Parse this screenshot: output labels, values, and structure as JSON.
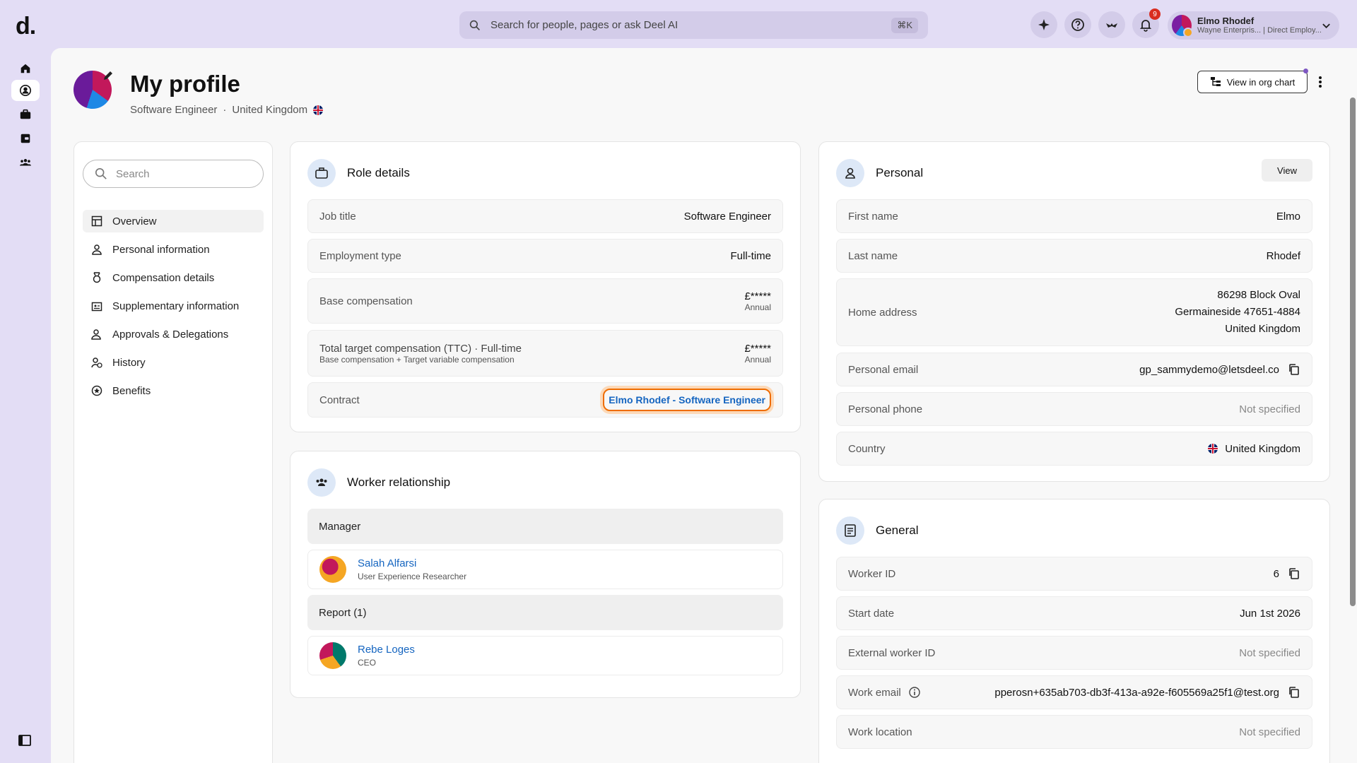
{
  "app": {
    "logo": "d."
  },
  "search": {
    "placeholder": "Search for people, pages or ask Deel AI",
    "shortcut": "⌘K"
  },
  "topbar": {
    "notification_count": "9"
  },
  "user": {
    "name": "Elmo Rhodef",
    "subtitle": "Wayne Enterpris... | Direct Employ..."
  },
  "header": {
    "title": "My profile",
    "job": "Software Engineer",
    "separator": "·",
    "country": "United Kingdom",
    "org_chart_button": "View in org chart"
  },
  "nav": {
    "search_placeholder": "Search",
    "items": [
      {
        "label": "Overview",
        "icon": "layout-icon"
      },
      {
        "label": "Personal information",
        "icon": "person-icon"
      },
      {
        "label": "Compensation details",
        "icon": "medal-icon"
      },
      {
        "label": "Supplementary information",
        "icon": "id-card-icon"
      },
      {
        "label": "Approvals & Delegations",
        "icon": "person-check-icon"
      },
      {
        "label": "History",
        "icon": "person-history-icon"
      },
      {
        "label": "Benefits",
        "icon": "star-badge-icon"
      }
    ]
  },
  "role": {
    "title": "Role details",
    "job_title_label": "Job title",
    "job_title": "Software Engineer",
    "employment_type_label": "Employment type",
    "employment_type": "Full-time",
    "base_comp_label": "Base compensation",
    "base_comp": "£*****",
    "base_comp_period": "Annual",
    "ttc_label": "Total target compensation (TTC) · Full-time",
    "ttc_sub": "Base compensation + Target variable compensation",
    "ttc": "£*****",
    "ttc_period": "Annual",
    "contract_label": "Contract",
    "contract": "Elmo Rhodef - Software Engineer"
  },
  "worker": {
    "title": "Worker relationship",
    "manager_label": "Manager",
    "manager_name": "Salah Alfarsi",
    "manager_role": "User Experience Researcher",
    "report_label": "Report (1)",
    "report_name": "Rebe Loges",
    "report_role": "CEO"
  },
  "personal": {
    "title": "Personal",
    "view_button": "View",
    "first_name_label": "First name",
    "first_name": "Elmo",
    "last_name_label": "Last name",
    "last_name": "Rhodef",
    "address_label": "Home address",
    "address_line1": "86298 Block Oval",
    "address_line2": "Germaineside 47651-4884",
    "address_line3": "United Kingdom",
    "email_label": "Personal email",
    "email": "gp_sammydemo@letsdeel.co",
    "phone_label": "Personal phone",
    "phone": "Not specified",
    "country_label": "Country",
    "country": "United Kingdom"
  },
  "general": {
    "title": "General",
    "worker_id_label": "Worker ID",
    "worker_id": "6",
    "start_date_label": "Start date",
    "start_date": "Jun 1st 2026",
    "external_id_label": "External worker ID",
    "external_id": "Not specified",
    "work_email_label": "Work email",
    "work_email": "pperosn+635ab703-db3f-413a-a92e-f605569a25f1@test.org",
    "work_location_label": "Work location",
    "work_location": "Not specified"
  }
}
